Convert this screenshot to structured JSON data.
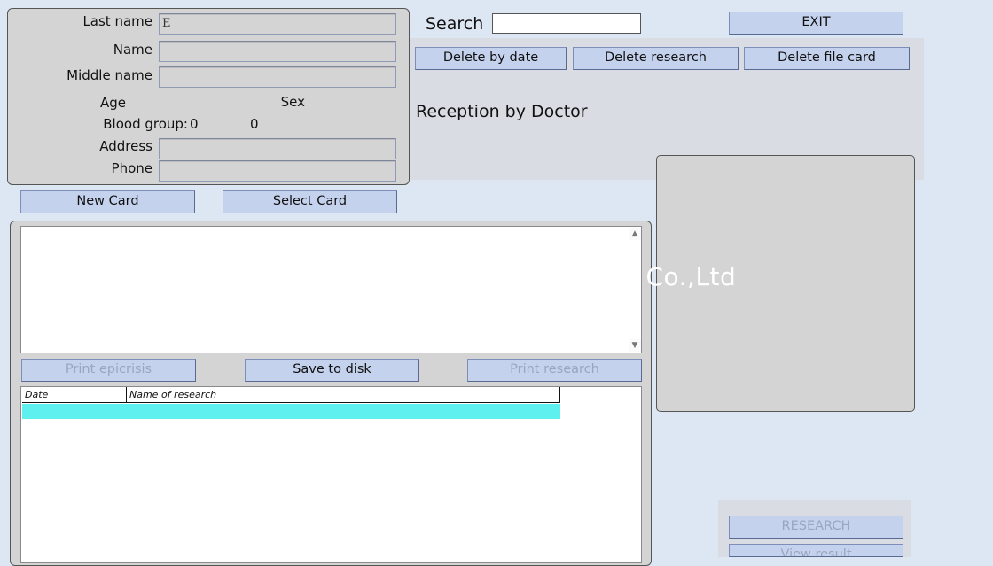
{
  "patient": {
    "last_name_label": "Last name",
    "last_name_value": "E",
    "name_label": "Name",
    "name_value": "",
    "middle_name_label": "Middle name",
    "middle_name_value": "",
    "age_label": "Age",
    "sex_label": "Sex",
    "blood_group_label": "Blood group:",
    "blood_group_value": "0",
    "rh_value": "0",
    "address_label": "Address",
    "address_value": "",
    "phone_label": "Phone",
    "phone_value": ""
  },
  "card_buttons": {
    "new_card": "New Card",
    "select_card": "Select Card"
  },
  "search": {
    "label": "Search",
    "value": ""
  },
  "top_buttons": {
    "exit": "EXIT",
    "delete_by_date": "Delete by date",
    "delete_research": "Delete research",
    "delete_file_card": "Delete file card"
  },
  "reception": {
    "title": "Reception by Doctor"
  },
  "action_buttons": {
    "print_epicrisis": "Print epicrisis",
    "save_to_disk": "Save to disk",
    "print_research": "Print research"
  },
  "research_table": {
    "columns": [
      "Date",
      "Name of research"
    ],
    "rows": [
      {
        "date": "",
        "name": ""
      }
    ]
  },
  "bottom_buttons": {
    "research": "RESEARCH",
    "view_result": "View result"
  },
  "watermark": {
    "text": "y Co.,Ltd"
  },
  "icons": {
    "scroll_up": "▲",
    "scroll_down": "▼"
  },
  "colors": {
    "background": "#dde6f3",
    "panel": "#d4d4d4",
    "button": "#c4d2ee",
    "selected_row": "#5ef0ef"
  }
}
